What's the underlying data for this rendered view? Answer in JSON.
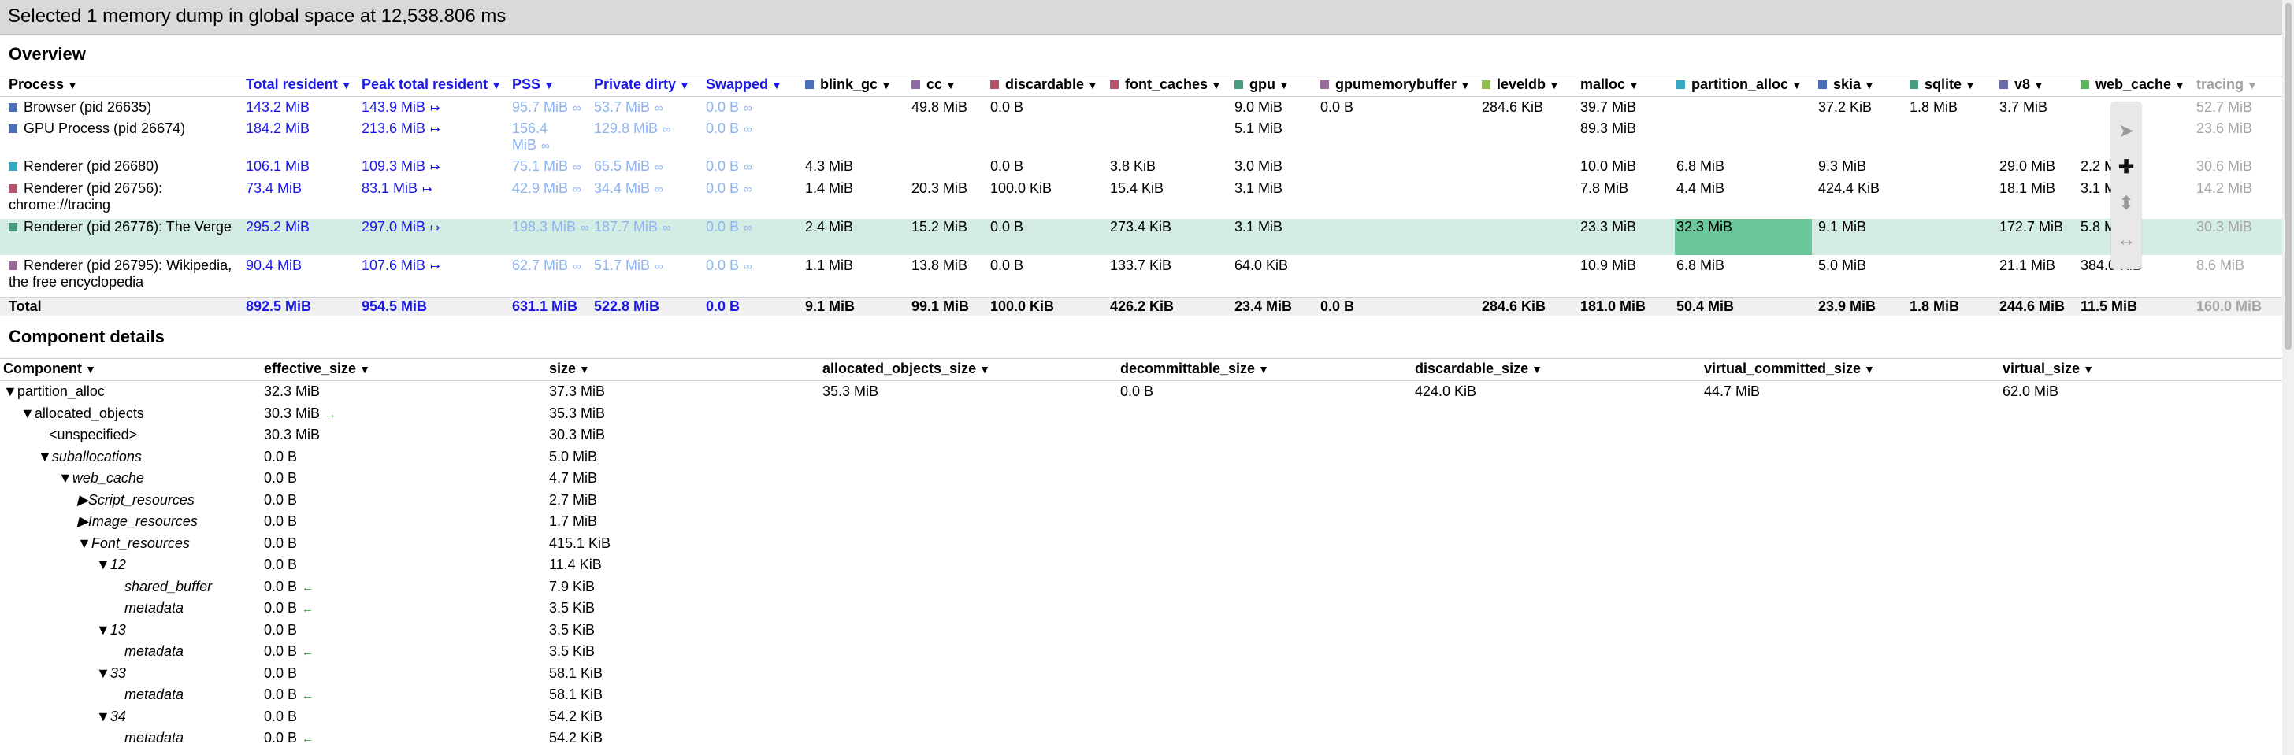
{
  "header": {
    "title": "Selected 1 memory dump in global space at 12,538.806 ms"
  },
  "overview": {
    "title": "Overview",
    "columns": [
      {
        "label": "Process",
        "color": null,
        "style": "black"
      },
      {
        "label": "Total resident",
        "color": null,
        "style": "blue"
      },
      {
        "label": "Peak total resident",
        "color": null,
        "style": "blue"
      },
      {
        "label": "PSS",
        "color": null,
        "style": "blue"
      },
      {
        "label": "Private dirty",
        "color": null,
        "style": "blue"
      },
      {
        "label": "Swapped",
        "color": null,
        "style": "blue"
      },
      {
        "label": "blink_gc",
        "color": "#4a6fb8",
        "style": "black"
      },
      {
        "label": "cc",
        "color": "#8d6aa3",
        "style": "black"
      },
      {
        "label": "discardable",
        "color": "#b5546a",
        "style": "black"
      },
      {
        "label": "font_caches",
        "color": "#b5546a",
        "style": "black"
      },
      {
        "label": "gpu",
        "color": "#4a9a7e",
        "style": "black"
      },
      {
        "label": "gpumemorybuffer",
        "color": "#9a6a9a",
        "style": "black"
      },
      {
        "label": "leveldb",
        "color": "#8dc044",
        "style": "black"
      },
      {
        "label": "malloc",
        "color": null,
        "style": "black"
      },
      {
        "label": "partition_alloc",
        "color": "#35a8c2",
        "style": "black"
      },
      {
        "label": "skia",
        "color": "#4a6fb8",
        "style": "black"
      },
      {
        "label": "sqlite",
        "color": "#4a9a7e",
        "style": "black"
      },
      {
        "label": "v8",
        "color": "#6a6aa8",
        "style": "black"
      },
      {
        "label": "web_cache",
        "color": "#5ab85a",
        "style": "black"
      },
      {
        "label": "tracing",
        "color": null,
        "style": "gray"
      }
    ],
    "rows": [
      {
        "process": "Browser (pid 26635)",
        "color": "#4a6fb8",
        "total_resident": "143.2 MiB",
        "peak": "143.9 MiB",
        "pss": "95.7 MiB",
        "private_dirty": "53.7 MiB",
        "swapped": "0.0 B",
        "blink_gc": "",
        "cc": "49.8 MiB",
        "discardable": "0.0 B",
        "font_caches": "",
        "gpu": "9.0 MiB",
        "gpumemorybuffer": "0.0 B",
        "leveldb": "284.6 KiB",
        "malloc": "39.7 MiB",
        "partition_alloc": "",
        "skia": "37.2 KiB",
        "sqlite": "1.8 MiB",
        "v8": "3.7 MiB",
        "web_cache": "",
        "tracing": "52.7 MiB"
      },
      {
        "process": "GPU Process (pid 26674)",
        "color": "#4a6fb8",
        "total_resident": "184.2 MiB",
        "peak": "213.6 MiB",
        "pss": "156.4 MiB",
        "private_dirty": "129.8 MiB",
        "swapped": "0.0 B",
        "blink_gc": "",
        "cc": "",
        "discardable": "",
        "font_caches": "",
        "gpu": "5.1 MiB",
        "gpumemorybuffer": "",
        "leveldb": "",
        "malloc": "89.3 MiB",
        "partition_alloc": "",
        "skia": "",
        "sqlite": "",
        "v8": "",
        "web_cache": "",
        "tracing": "23.6 MiB"
      },
      {
        "process": "Renderer (pid 26680)",
        "color": "#35a8c2",
        "total_resident": "106.1 MiB",
        "peak": "109.3 MiB",
        "pss": "75.1 MiB",
        "private_dirty": "65.5 MiB",
        "swapped": "0.0 B",
        "blink_gc": "4.3 MiB",
        "cc": "",
        "discardable": "0.0 B",
        "font_caches": "3.8 KiB",
        "gpu": "3.0 MiB",
        "gpumemorybuffer": "",
        "leveldb": "",
        "malloc": "10.0 MiB",
        "partition_alloc": "6.8 MiB",
        "skia": "9.3 MiB",
        "sqlite": "",
        "v8": "29.0 MiB",
        "web_cache": "2.2 M",
        "tracing": "30.6 MiB"
      },
      {
        "process": "Renderer (pid 26756): chrome://tracing",
        "color": "#b5546a",
        "total_resident": "73.4 MiB",
        "peak": "83.1 MiB",
        "pss": "42.9 MiB",
        "private_dirty": "34.4 MiB",
        "swapped": "0.0 B",
        "blink_gc": "1.4 MiB",
        "cc": "20.3 MiB",
        "discardable": "100.0 KiB",
        "font_caches": "15.4 KiB",
        "gpu": "3.1 MiB",
        "gpumemorybuffer": "",
        "leveldb": "",
        "malloc": "7.8 MiB",
        "partition_alloc": "4.4 MiB",
        "skia": "424.4 KiB",
        "sqlite": "",
        "v8": "18.1 MiB",
        "web_cache": "3.1 M",
        "tracing": "14.2 MiB"
      },
      {
        "process": "Renderer (pid 26776): The Verge",
        "color": "#4a9a7e",
        "total_resident": "295.2 MiB",
        "peak": "297.0 MiB",
        "pss": "198.3 MiB",
        "private_dirty": "187.7 MiB",
        "swapped": "0.0 B",
        "blink_gc": "2.4 MiB",
        "cc": "15.2 MiB",
        "discardable": "0.0 B",
        "font_caches": "273.4 KiB",
        "gpu": "3.1 MiB",
        "gpumemorybuffer": "",
        "leveldb": "",
        "malloc": "23.3 MiB",
        "partition_alloc": "32.3 MiB",
        "skia": "9.1 MiB",
        "sqlite": "",
        "v8": "172.7 MiB",
        "web_cache": "5.8 M",
        "tracing": "30.3 MiB"
      },
      {
        "process": "Renderer (pid 26795): Wikipedia, the free encyclopedia",
        "color": "#9a6a9a",
        "total_resident": "90.4 MiB",
        "peak": "107.6 MiB",
        "pss": "62.7 MiB",
        "private_dirty": "51.7 MiB",
        "swapped": "0.0 B",
        "blink_gc": "1.1 MiB",
        "cc": "13.8 MiB",
        "discardable": "0.0 B",
        "font_caches": "133.7 KiB",
        "gpu": "64.0 KiB",
        "gpumemorybuffer": "",
        "leveldb": "",
        "malloc": "10.9 MiB",
        "partition_alloc": "6.8 MiB",
        "skia": "5.0 MiB",
        "sqlite": "",
        "v8": "21.1 MiB",
        "web_cache": "384.0 KiB",
        "tracing": "8.6 MiB"
      }
    ],
    "total": {
      "process": "Total",
      "total_resident": "892.5 MiB",
      "peak": "954.5 MiB",
      "pss": "631.1 MiB",
      "private_dirty": "522.8 MiB",
      "swapped": "0.0 B",
      "blink_gc": "9.1 MiB",
      "cc": "99.1 MiB",
      "discardable": "100.0 KiB",
      "font_caches": "426.2 KiB",
      "gpu": "23.4 MiB",
      "gpumemorybuffer": "0.0 B",
      "leveldb": "284.6 KiB",
      "malloc": "181.0 MiB",
      "partition_alloc": "50.4 MiB",
      "skia": "23.9 MiB",
      "sqlite": "1.8 MiB",
      "v8": "244.6 MiB",
      "web_cache": "11.5 MiB",
      "tracing": "160.0 MiB"
    }
  },
  "component_details": {
    "title": "Component details",
    "columns": [
      "Component",
      "effective_size",
      "size",
      "allocated_objects_size",
      "decommittable_size",
      "discardable_size",
      "virtual_committed_size",
      "virtual_size"
    ],
    "rows": [
      {
        "name": "partition_alloc",
        "toggle": "▼",
        "italic": false,
        "effective": "32.3 MiB",
        "eff_arrow": "",
        "size": "37.3 MiB",
        "allocated": "35.3 MiB",
        "decommittable": "0.0 B",
        "discardable": "424.0 KiB",
        "virtual_committed": "44.7 MiB",
        "virtual": "62.0 MiB"
      },
      {
        "name": "allocated_objects",
        "toggle": "▼",
        "italic": false,
        "effective": "30.3 MiB",
        "eff_arrow": "→",
        "size": "35.3 MiB",
        "allocated": "",
        "decommittable": "",
        "discardable": "",
        "virtual_committed": "",
        "virtual": ""
      },
      {
        "name": "<unspecified>",
        "toggle": "",
        "italic": false,
        "effective": "30.3 MiB",
        "eff_arrow": "",
        "size": "30.3 MiB",
        "allocated": "",
        "decommittable": "",
        "discardable": "",
        "virtual_committed": "",
        "virtual": ""
      },
      {
        "name": "suballocations",
        "toggle": "▼",
        "italic": true,
        "effective": "0.0 B",
        "eff_arrow": "",
        "size": "5.0 MiB",
        "allocated": "",
        "decommittable": "",
        "discardable": "",
        "virtual_committed": "",
        "virtual": ""
      },
      {
        "name": "web_cache",
        "toggle": "▼",
        "italic": true,
        "effective": "0.0 B",
        "eff_arrow": "",
        "size": "4.7 MiB",
        "allocated": "",
        "decommittable": "",
        "discardable": "",
        "virtual_committed": "",
        "virtual": ""
      },
      {
        "name": "Script_resources",
        "toggle": "▶",
        "italic": true,
        "effective": "0.0 B",
        "eff_arrow": "",
        "size": "2.7 MiB",
        "allocated": "",
        "decommittable": "",
        "discardable": "",
        "virtual_committed": "",
        "virtual": ""
      },
      {
        "name": "Image_resources",
        "toggle": "▶",
        "italic": true,
        "effective": "0.0 B",
        "eff_arrow": "",
        "size": "1.7 MiB",
        "allocated": "",
        "decommittable": "",
        "discardable": "",
        "virtual_committed": "",
        "virtual": ""
      },
      {
        "name": "Font_resources",
        "toggle": "▼",
        "italic": true,
        "effective": "0.0 B",
        "eff_arrow": "",
        "size": "415.1 KiB",
        "allocated": "",
        "decommittable": "",
        "discardable": "",
        "virtual_committed": "",
        "virtual": ""
      },
      {
        "name": "12",
        "toggle": "▼",
        "italic": true,
        "effective": "0.0 B",
        "eff_arrow": "",
        "size": "11.4 KiB",
        "allocated": "",
        "decommittable": "",
        "discardable": "",
        "virtual_committed": "",
        "virtual": ""
      },
      {
        "name": "shared_buffer",
        "toggle": "",
        "italic": true,
        "effective": "0.0 B",
        "eff_arrow": "←",
        "size": "7.9 KiB",
        "allocated": "",
        "decommittable": "",
        "discardable": "",
        "virtual_committed": "",
        "virtual": ""
      },
      {
        "name": "metadata",
        "toggle": "",
        "italic": true,
        "effective": "0.0 B",
        "eff_arrow": "←",
        "size": "3.5 KiB",
        "allocated": "",
        "decommittable": "",
        "discardable": "",
        "virtual_committed": "",
        "virtual": ""
      },
      {
        "name": "13",
        "toggle": "▼",
        "italic": true,
        "effective": "0.0 B",
        "eff_arrow": "",
        "size": "3.5 KiB",
        "allocated": "",
        "decommittable": "",
        "discardable": "",
        "virtual_committed": "",
        "virtual": ""
      },
      {
        "name": "metadata",
        "toggle": "",
        "italic": true,
        "effective": "0.0 B",
        "eff_arrow": "←",
        "size": "3.5 KiB",
        "allocated": "",
        "decommittable": "",
        "discardable": "",
        "virtual_committed": "",
        "virtual": ""
      },
      {
        "name": "33",
        "toggle": "▼",
        "italic": true,
        "effective": "0.0 B",
        "eff_arrow": "",
        "size": "58.1 KiB",
        "allocated": "",
        "decommittable": "",
        "discardable": "",
        "virtual_committed": "",
        "virtual": ""
      },
      {
        "name": "metadata",
        "toggle": "",
        "italic": true,
        "effective": "0.0 B",
        "eff_arrow": "←",
        "size": "58.1 KiB",
        "allocated": "",
        "decommittable": "",
        "discardable": "",
        "virtual_committed": "",
        "virtual": ""
      },
      {
        "name": "34",
        "toggle": "▼",
        "italic": true,
        "effective": "0.0 B",
        "eff_arrow": "",
        "size": "54.2 KiB",
        "allocated": "",
        "decommittable": "",
        "discardable": "",
        "virtual_committed": "",
        "virtual": ""
      },
      {
        "name": "metadata",
        "toggle": "",
        "italic": true,
        "effective": "0.0 B",
        "eff_arrow": "←",
        "size": "54.2 KiB",
        "allocated": "",
        "decommittable": "",
        "discardable": "",
        "virtual_committed": "",
        "virtual": ""
      }
    ]
  },
  "toolbar": {
    "tools": [
      {
        "icon": "pointer-icon",
        "glyph": "➤",
        "active": false
      },
      {
        "icon": "pan-icon",
        "glyph": "✚",
        "active": true
      },
      {
        "icon": "zoom-icon",
        "glyph": "⬍",
        "active": false
      },
      {
        "icon": "timing-icon",
        "glyph": "↔",
        "active": false
      }
    ]
  },
  "symbols": {
    "ratchet": "↦",
    "infinity": "∞",
    "sort": "▼"
  },
  "colors": {
    "highlight_row": "#d4ede4",
    "highlight_cell": "#69c79a",
    "link_blue": "#1a18e6"
  }
}
